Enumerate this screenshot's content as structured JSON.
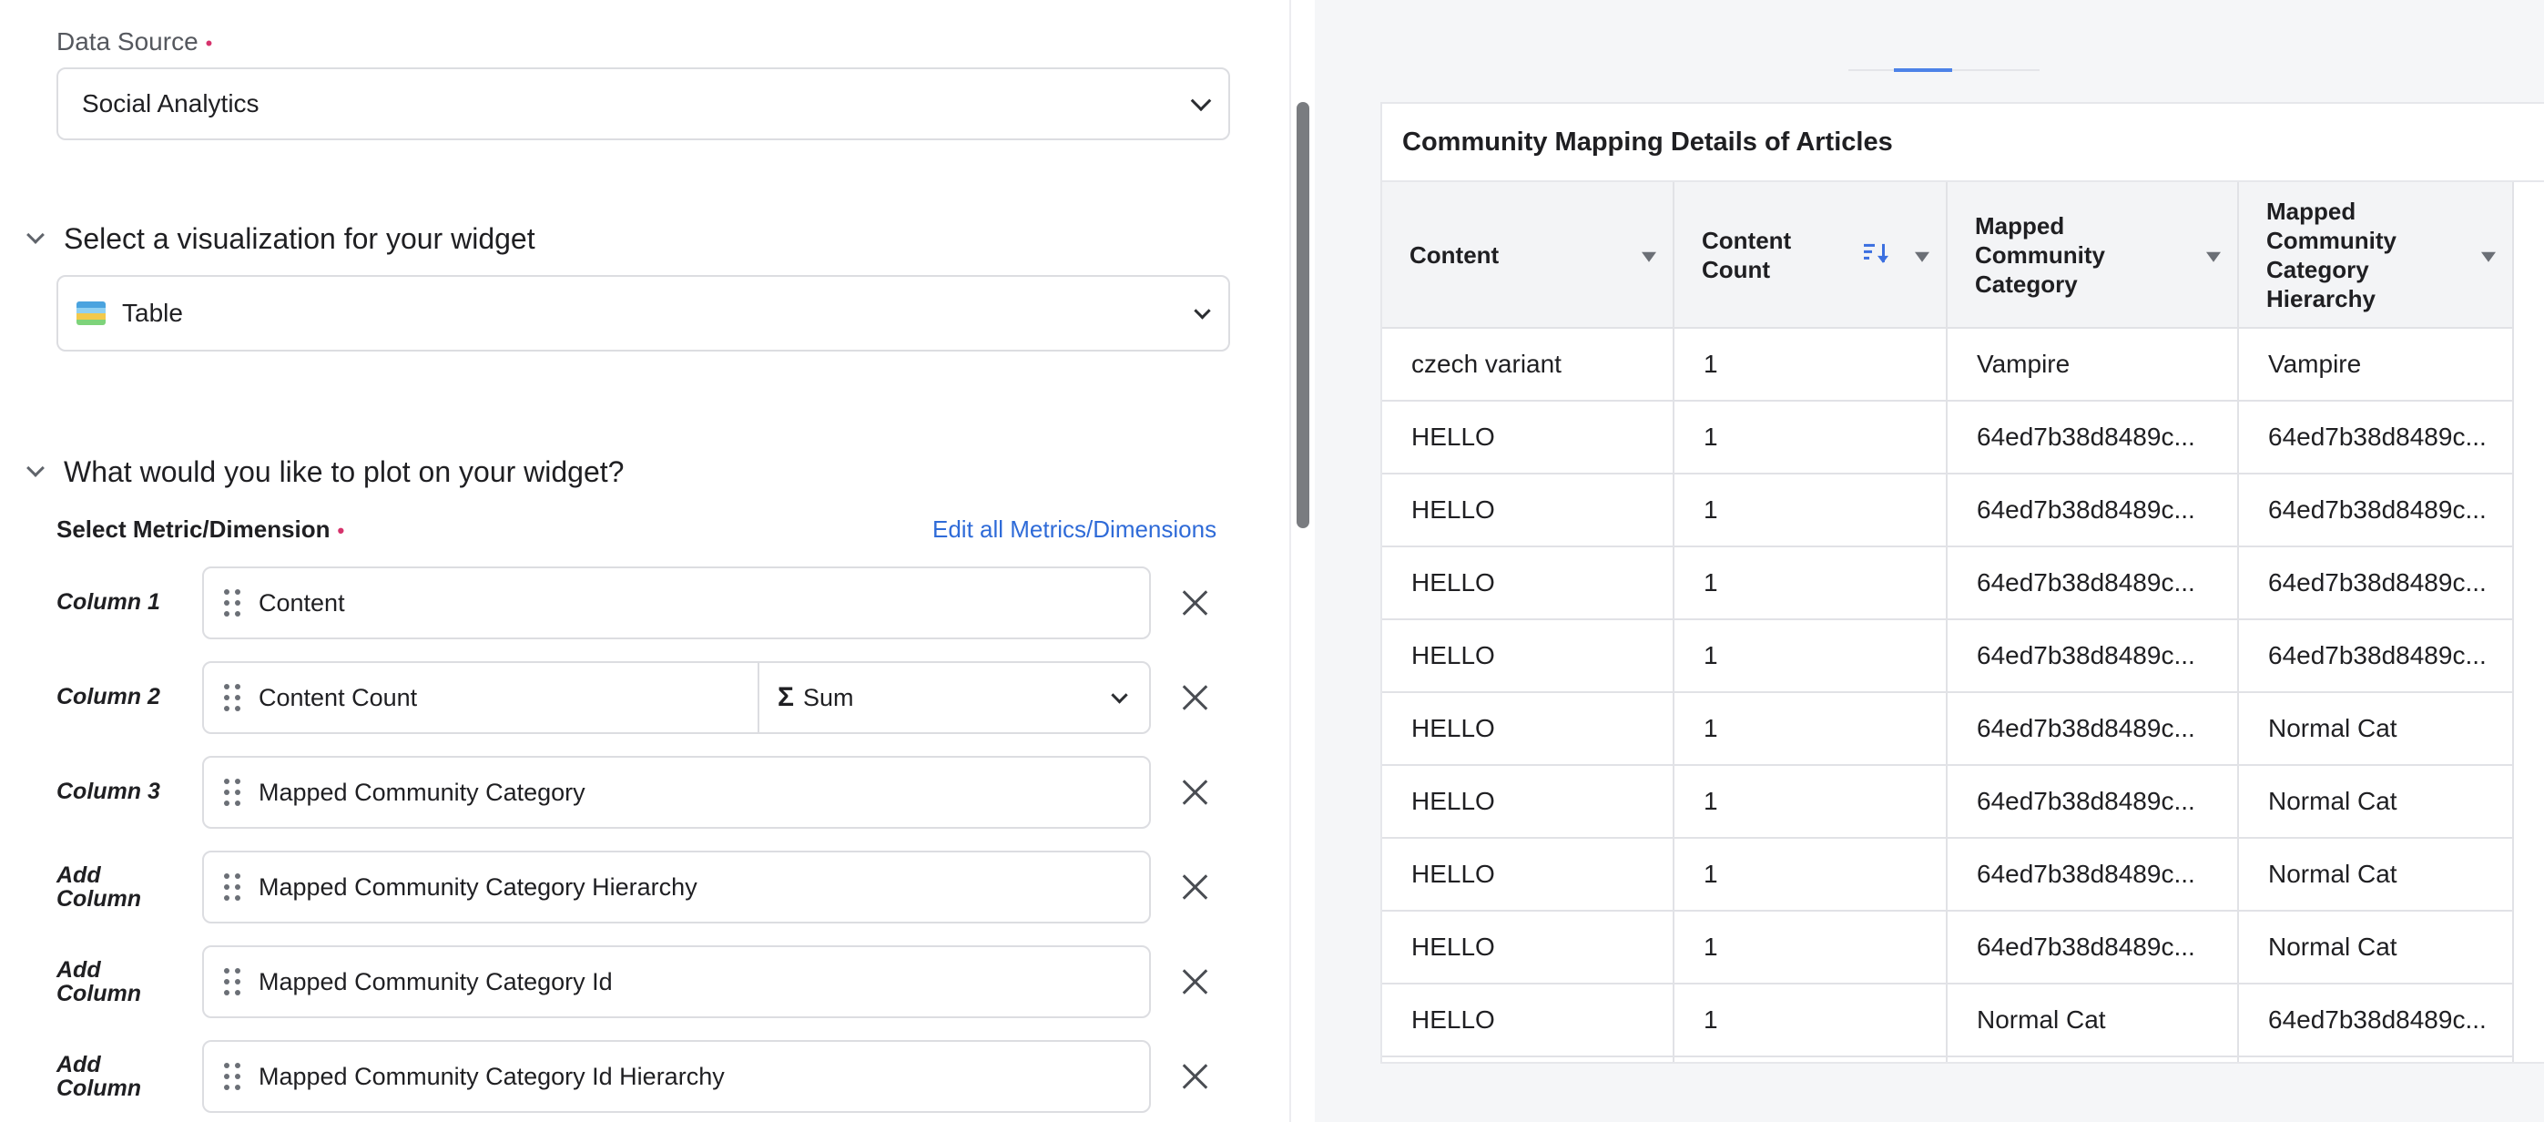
{
  "data_source": {
    "label": "Data Source",
    "value": "Social Analytics"
  },
  "visualization": {
    "heading": "Select a visualization for your widget",
    "value": "Table",
    "icon": "table-color-icon"
  },
  "plot": {
    "heading": "What would you like to plot on your widget?",
    "metric_label": "Select Metric/Dimension",
    "edit_link": "Edit all Metrics/Dimensions",
    "columns": [
      {
        "name": "Column 1",
        "value": "Content"
      },
      {
        "name": "Column 2",
        "value": "Content Count",
        "aggregation": "Sum"
      },
      {
        "name": "Column 3",
        "value": "Mapped Community Category"
      },
      {
        "name": "Add Column",
        "value": "Mapped Community Category Hierarchy"
      },
      {
        "name": "Add Column",
        "value": "Mapped Community Category Id"
      },
      {
        "name": "Add Column",
        "value": "Mapped Community Category Id Hierarchy"
      }
    ]
  },
  "preview": {
    "title": "Community Mapping Details of Articles",
    "headers": [
      "Content",
      "Content Count",
      "Mapped Community Category",
      "Mapped Community Category Hierarchy"
    ],
    "rows": [
      [
        "czech variant",
        "1",
        "Vampire",
        "Vampire"
      ],
      [
        "HELLO",
        "1",
        "64ed7b38d8489c...",
        "64ed7b38d8489c..."
      ],
      [
        "HELLO",
        "1",
        "64ed7b38d8489c...",
        "64ed7b38d8489c..."
      ],
      [
        "HELLO",
        "1",
        "64ed7b38d8489c...",
        "64ed7b38d8489c..."
      ],
      [
        "HELLO",
        "1",
        "64ed7b38d8489c...",
        "64ed7b38d8489c..."
      ],
      [
        "HELLO",
        "1",
        "64ed7b38d8489c...",
        "Normal Cat"
      ],
      [
        "HELLO",
        "1",
        "64ed7b38d8489c...",
        "Normal Cat"
      ],
      [
        "HELLO",
        "1",
        "64ed7b38d8489c...",
        "Normal Cat"
      ],
      [
        "HELLO",
        "1",
        "64ed7b38d8489c...",
        "Normal Cat"
      ],
      [
        "HELLO",
        "1",
        "Normal Cat",
        "64ed7b38d8489c..."
      ],
      [
        "",
        "",
        "",
        ""
      ]
    ]
  },
  "colors": {
    "accent": "#2f6bd8",
    "required": "#d6336c",
    "panel_bg": "#f5f6f8"
  }
}
